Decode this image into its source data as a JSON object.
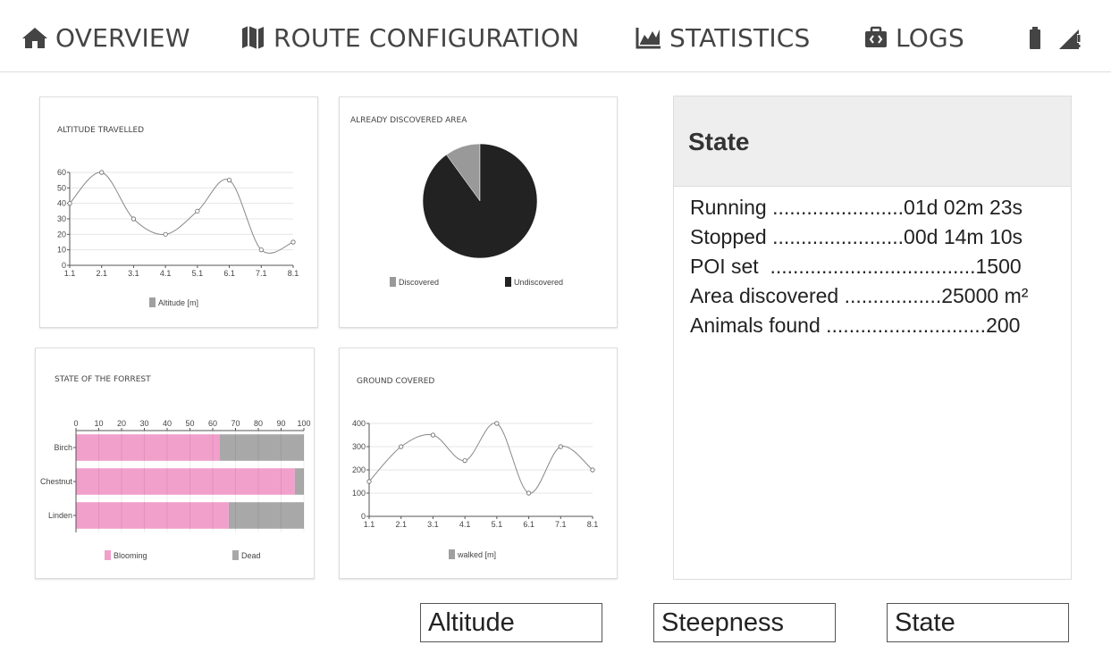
{
  "nav": {
    "items": [
      {
        "label": "OVERVIEW",
        "icon": "home-icon"
      },
      {
        "label": "ROUTE CONFIGURATION",
        "icon": "map-icon"
      },
      {
        "label": "STATISTICS",
        "icon": "area-chart-icon"
      },
      {
        "label": "LOGS",
        "icon": "code-briefcase-icon"
      }
    ],
    "status_icons": [
      "battery-icon",
      "signal-warning-icon"
    ]
  },
  "colors": {
    "line": "#888888",
    "grid": "#e6e6e6",
    "legend_grey": "#a0a0a0",
    "pie_discovered": "#999999",
    "pie_undiscovered": "#222222",
    "bar_blooming": "#f19fcb",
    "bar_dead": "#a8a8a8",
    "panel_header": "#eeeeee"
  },
  "chart_data": [
    {
      "type": "line",
      "title": "ALTITUDE TRAVELLED",
      "x": [
        "1.1",
        "2.1",
        "3.1",
        "4.1",
        "5.1",
        "6.1",
        "7.1",
        "8.1"
      ],
      "series": [
        {
          "name": "Altitude [m]",
          "values": [
            40,
            60,
            30,
            20,
            35,
            55,
            10,
            15
          ]
        }
      ],
      "ylim": [
        0,
        60
      ],
      "yticks": [
        0,
        10,
        20,
        30,
        40,
        50,
        60
      ],
      "grid": true,
      "legend": "bottom"
    },
    {
      "type": "pie",
      "title": "ALREADY DISCOVERED AREA",
      "slices": [
        {
          "name": "Discovered",
          "value": 10
        },
        {
          "name": "Undiscovered",
          "value": 90
        }
      ],
      "legend": "bottom"
    },
    {
      "type": "bar",
      "orientation": "horizontal",
      "stacked": true,
      "title": "STATE OF THE FORREST",
      "categories": [
        "Birch",
        "Chestnut",
        "Linden"
      ],
      "series": [
        {
          "name": "Blooming",
          "values": [
            63,
            96,
            67
          ]
        },
        {
          "name": "Dead",
          "values": [
            37,
            4,
            33
          ]
        }
      ],
      "xlim": [
        0,
        100
      ],
      "xticks": [
        0,
        10,
        20,
        30,
        40,
        50,
        60,
        70,
        80,
        90,
        100
      ],
      "grid": true,
      "legend": "bottom"
    },
    {
      "type": "line",
      "title": "GROUND COVERED",
      "x": [
        "1.1",
        "2.1",
        "3.1",
        "4.1",
        "5.1",
        "6.1",
        "7.1",
        "8.1"
      ],
      "series": [
        {
          "name": "walked [m]",
          "values": [
            150,
            300,
            350,
            240,
            400,
            100,
            300,
            200
          ]
        }
      ],
      "ylim": [
        0,
        400
      ],
      "yticks": [
        0,
        100,
        200,
        300,
        400
      ],
      "grid": true,
      "legend": "bottom"
    }
  ],
  "state": {
    "title": "State",
    "rows": [
      "Running .......................01d 02m 23s",
      "Stopped .......................00d 14m 10s",
      "POI set  ....................................1500",
      "Area discovered .................25000 m²",
      "Animals found ............................200"
    ]
  },
  "buttons": {
    "altitude": "Altitude",
    "steepness": "Steepness",
    "state": "State"
  }
}
